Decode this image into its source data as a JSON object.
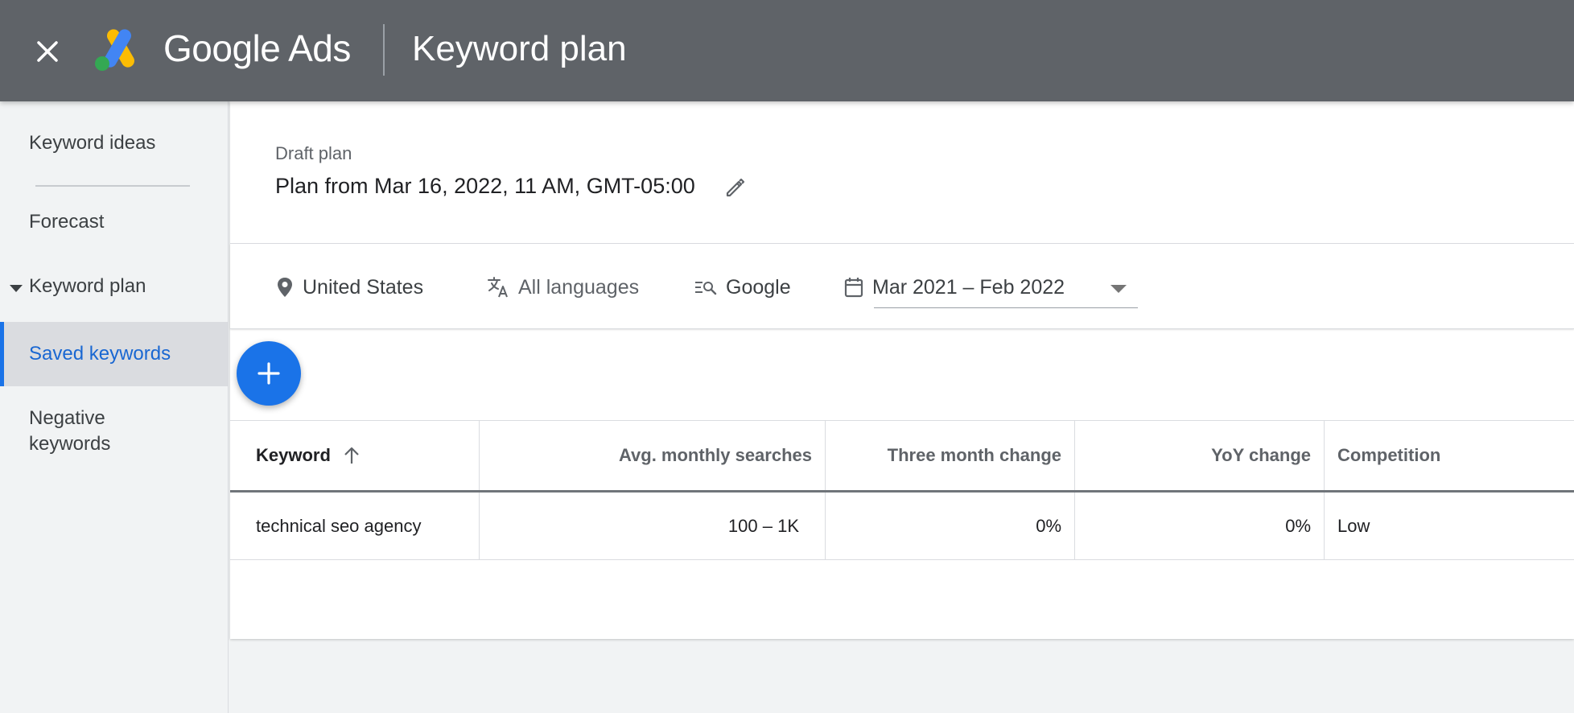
{
  "header": {
    "brand_google": "Google",
    "brand_ads": "Ads",
    "title": "Keyword plan",
    "background": "#5f6368"
  },
  "sidebar": {
    "items": [
      {
        "label": "Keyword ideas"
      },
      {
        "label": "Forecast"
      },
      {
        "label": "Keyword plan",
        "expanded": true
      },
      {
        "label": "Saved keywords",
        "active": true
      },
      {
        "label": "Negative keywords"
      }
    ],
    "accent_color": "#1a73e8"
  },
  "plan": {
    "status": "Draft plan",
    "name": "Plan from Mar 16, 2022, 11 AM, GMT-05:00"
  },
  "filters": {
    "location": "United States",
    "language": "All languages",
    "network": "Google",
    "date_range": "Mar 2021 – Feb 2022"
  },
  "table": {
    "columns": [
      "Keyword",
      "Avg. monthly searches",
      "Three month change",
      "YoY change",
      "Competition"
    ],
    "sorted_by": "Keyword",
    "rows": [
      {
        "keyword": "technical seo agency",
        "avg_monthly_searches": "100 – 1K",
        "three_month_change": "0%",
        "yoy_change": "0%",
        "competition": "Low"
      }
    ]
  },
  "icons": {
    "close": "close-icon",
    "edit": "pencil-icon",
    "location": "map-pin-icon",
    "language": "translate-icon",
    "network": "search-network-icon",
    "calendar": "calendar-icon",
    "add": "plus-icon",
    "sort": "arrow-up-icon"
  }
}
